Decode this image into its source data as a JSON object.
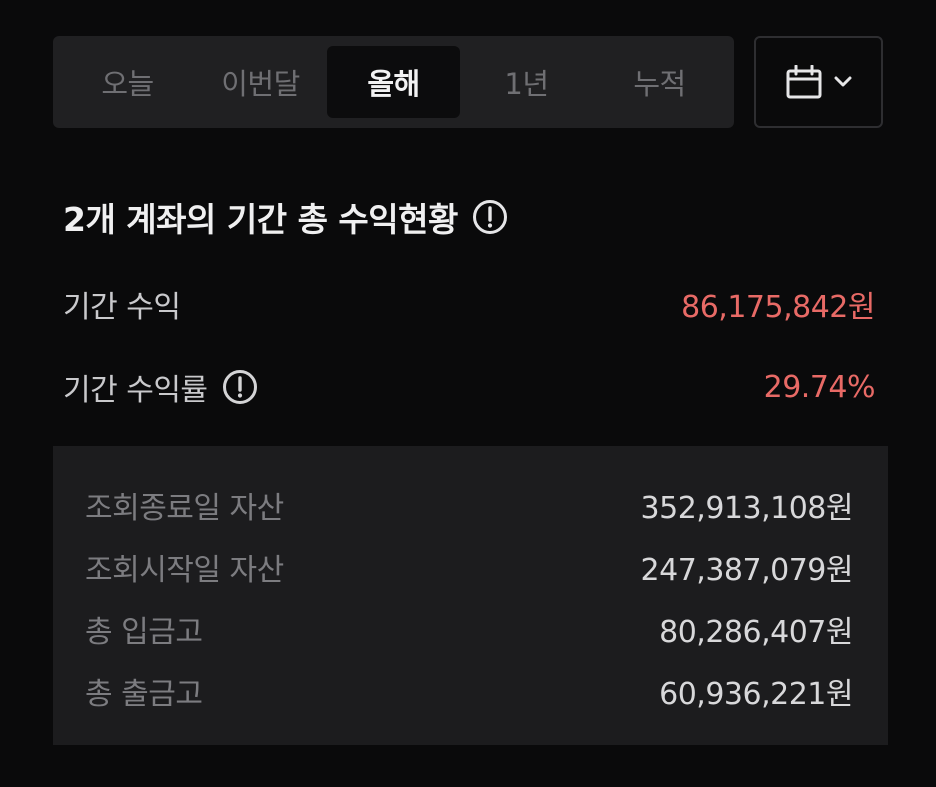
{
  "tabs": [
    {
      "label": "오늘",
      "active": false
    },
    {
      "label": "이번달",
      "active": false
    },
    {
      "label": "올해",
      "active": true
    },
    {
      "label": "1년",
      "active": false
    },
    {
      "label": "누적",
      "active": false
    }
  ],
  "calendar_button": {
    "icon": "calendar-icon",
    "chevron_icon": "chevron-down-icon"
  },
  "summary": {
    "title": "2개 계좌의 기간 총 수익현황",
    "profit_label": "기간 수익",
    "profit_value": "86,175,842원",
    "rate_label": "기간 수익률",
    "rate_value": "29.74%"
  },
  "details": [
    {
      "label": "조회종료일 자산",
      "value": "352,913,108원"
    },
    {
      "label": "조회시작일 자산",
      "value": "247,387,079원"
    },
    {
      "label": "총 입금고",
      "value": "80,286,407원"
    },
    {
      "label": "총 출금고",
      "value": "60,936,221원"
    }
  ],
  "colors": {
    "background": "#0a0a0b",
    "profit_red": "#e86a66",
    "panel": "#1c1c1e",
    "tab_bar": "#202022"
  }
}
